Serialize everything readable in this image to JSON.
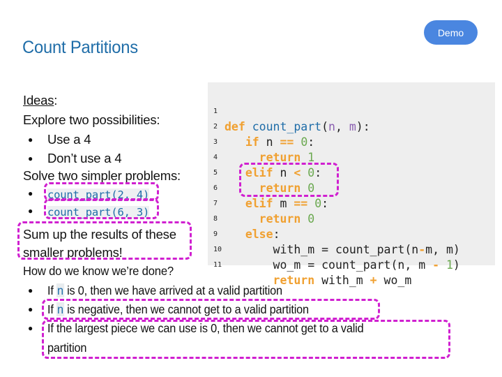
{
  "header": {
    "title": "Count Partitions",
    "demo_button": "Demo"
  },
  "colors": {
    "title": "#1f6da8",
    "demo_button_bg": "#4a86e0",
    "highlight_box": "#d020d0",
    "keyword": "#f0a030",
    "function_name": "#1f6da8",
    "number": "#6aa84f",
    "param": "#8a5fb0",
    "code_bg": "#eeeeee"
  },
  "left": {
    "ideas_label": "Ideas",
    "ideas_colon": ":",
    "explore": "Explore two possibilities:",
    "possibilities": [
      "Use a 4",
      "Don’t use a 4"
    ],
    "solve": "Solve two simpler problems:",
    "subproblems": [
      "count_part(2, 4)",
      "count_part(6, 3)"
    ],
    "sum_line1": "Sum up the results of these",
    "sum_line2": "smaller problems!",
    "done_question": "How do we know we’re done?",
    "base_cases": [
      {
        "pre": "If ",
        "code": "n",
        "post": " is 0, then we have arrived at a valid partition"
      },
      {
        "pre": "If ",
        "code": "n",
        "post": " is negative, then we cannot get to a valid partition"
      },
      {
        "line1": "If the largest piece we can use is 0, then we cannot get to a valid",
        "line2": "partition"
      }
    ]
  },
  "code": {
    "line_numbers": [
      "1",
      "2",
      "3",
      "4",
      "5",
      "6",
      "7",
      "8",
      "9",
      "10",
      "11"
    ],
    "lines": [
      "def count_part(n, m):",
      "    if n == 0:",
      "      return 1",
      "    elif n < 0:",
      "      return 0",
      "    elif m == 0:",
      "      return 0",
      "    else:",
      "        with_m = count_part(n-m, m)",
      "        wo_m = count_part(n, m - 1)",
      "        return with_m + wo_m"
    ],
    "tokens": {
      "def": "def",
      "fn_name": "count_part",
      "n": "n",
      "m": "m",
      "if": "if",
      "elif": "elif",
      "else": "else",
      "return": "return",
      "eq": "==",
      "lt": "<",
      "zero": "0",
      "one": "1",
      "with_m": "with_m",
      "wo_m": "wo_m",
      "assign": "=",
      "minus": "-",
      "plus": "+"
    }
  }
}
